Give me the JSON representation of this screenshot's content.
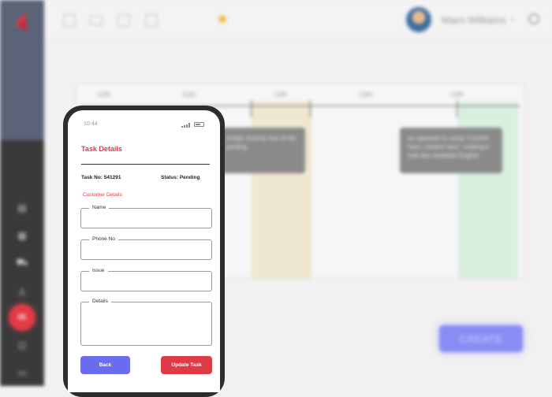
{
  "background": {
    "user_name": "Marri Williams",
    "timeline": {
      "ticks": [
        "10th",
        "11th",
        "12th",
        "13th",
        "14th"
      ],
      "tooltips": [
        "simply dummy text of the printing",
        "as opposed to using 'Content here, content here', making it look like readable English"
      ]
    },
    "create_label": "CREATE"
  },
  "phone": {
    "time": "10:44",
    "title": "Task Details",
    "task_no": "Task No: 541291",
    "status": "Status: Pending",
    "section": "Customer Details",
    "fields": {
      "name": {
        "label": "Name",
        "value": ""
      },
      "phone": {
        "label": "Phone No",
        "value": ""
      },
      "issue": {
        "label": "Issue",
        "value": ""
      },
      "details": {
        "label": "Details",
        "value": ""
      }
    },
    "back_label": "Back",
    "update_label": "Update Task"
  },
  "colors": {
    "accent_red": "#df3b47",
    "accent_blue": "#6a6cf0",
    "sidebar": "#3a3a3a"
  }
}
